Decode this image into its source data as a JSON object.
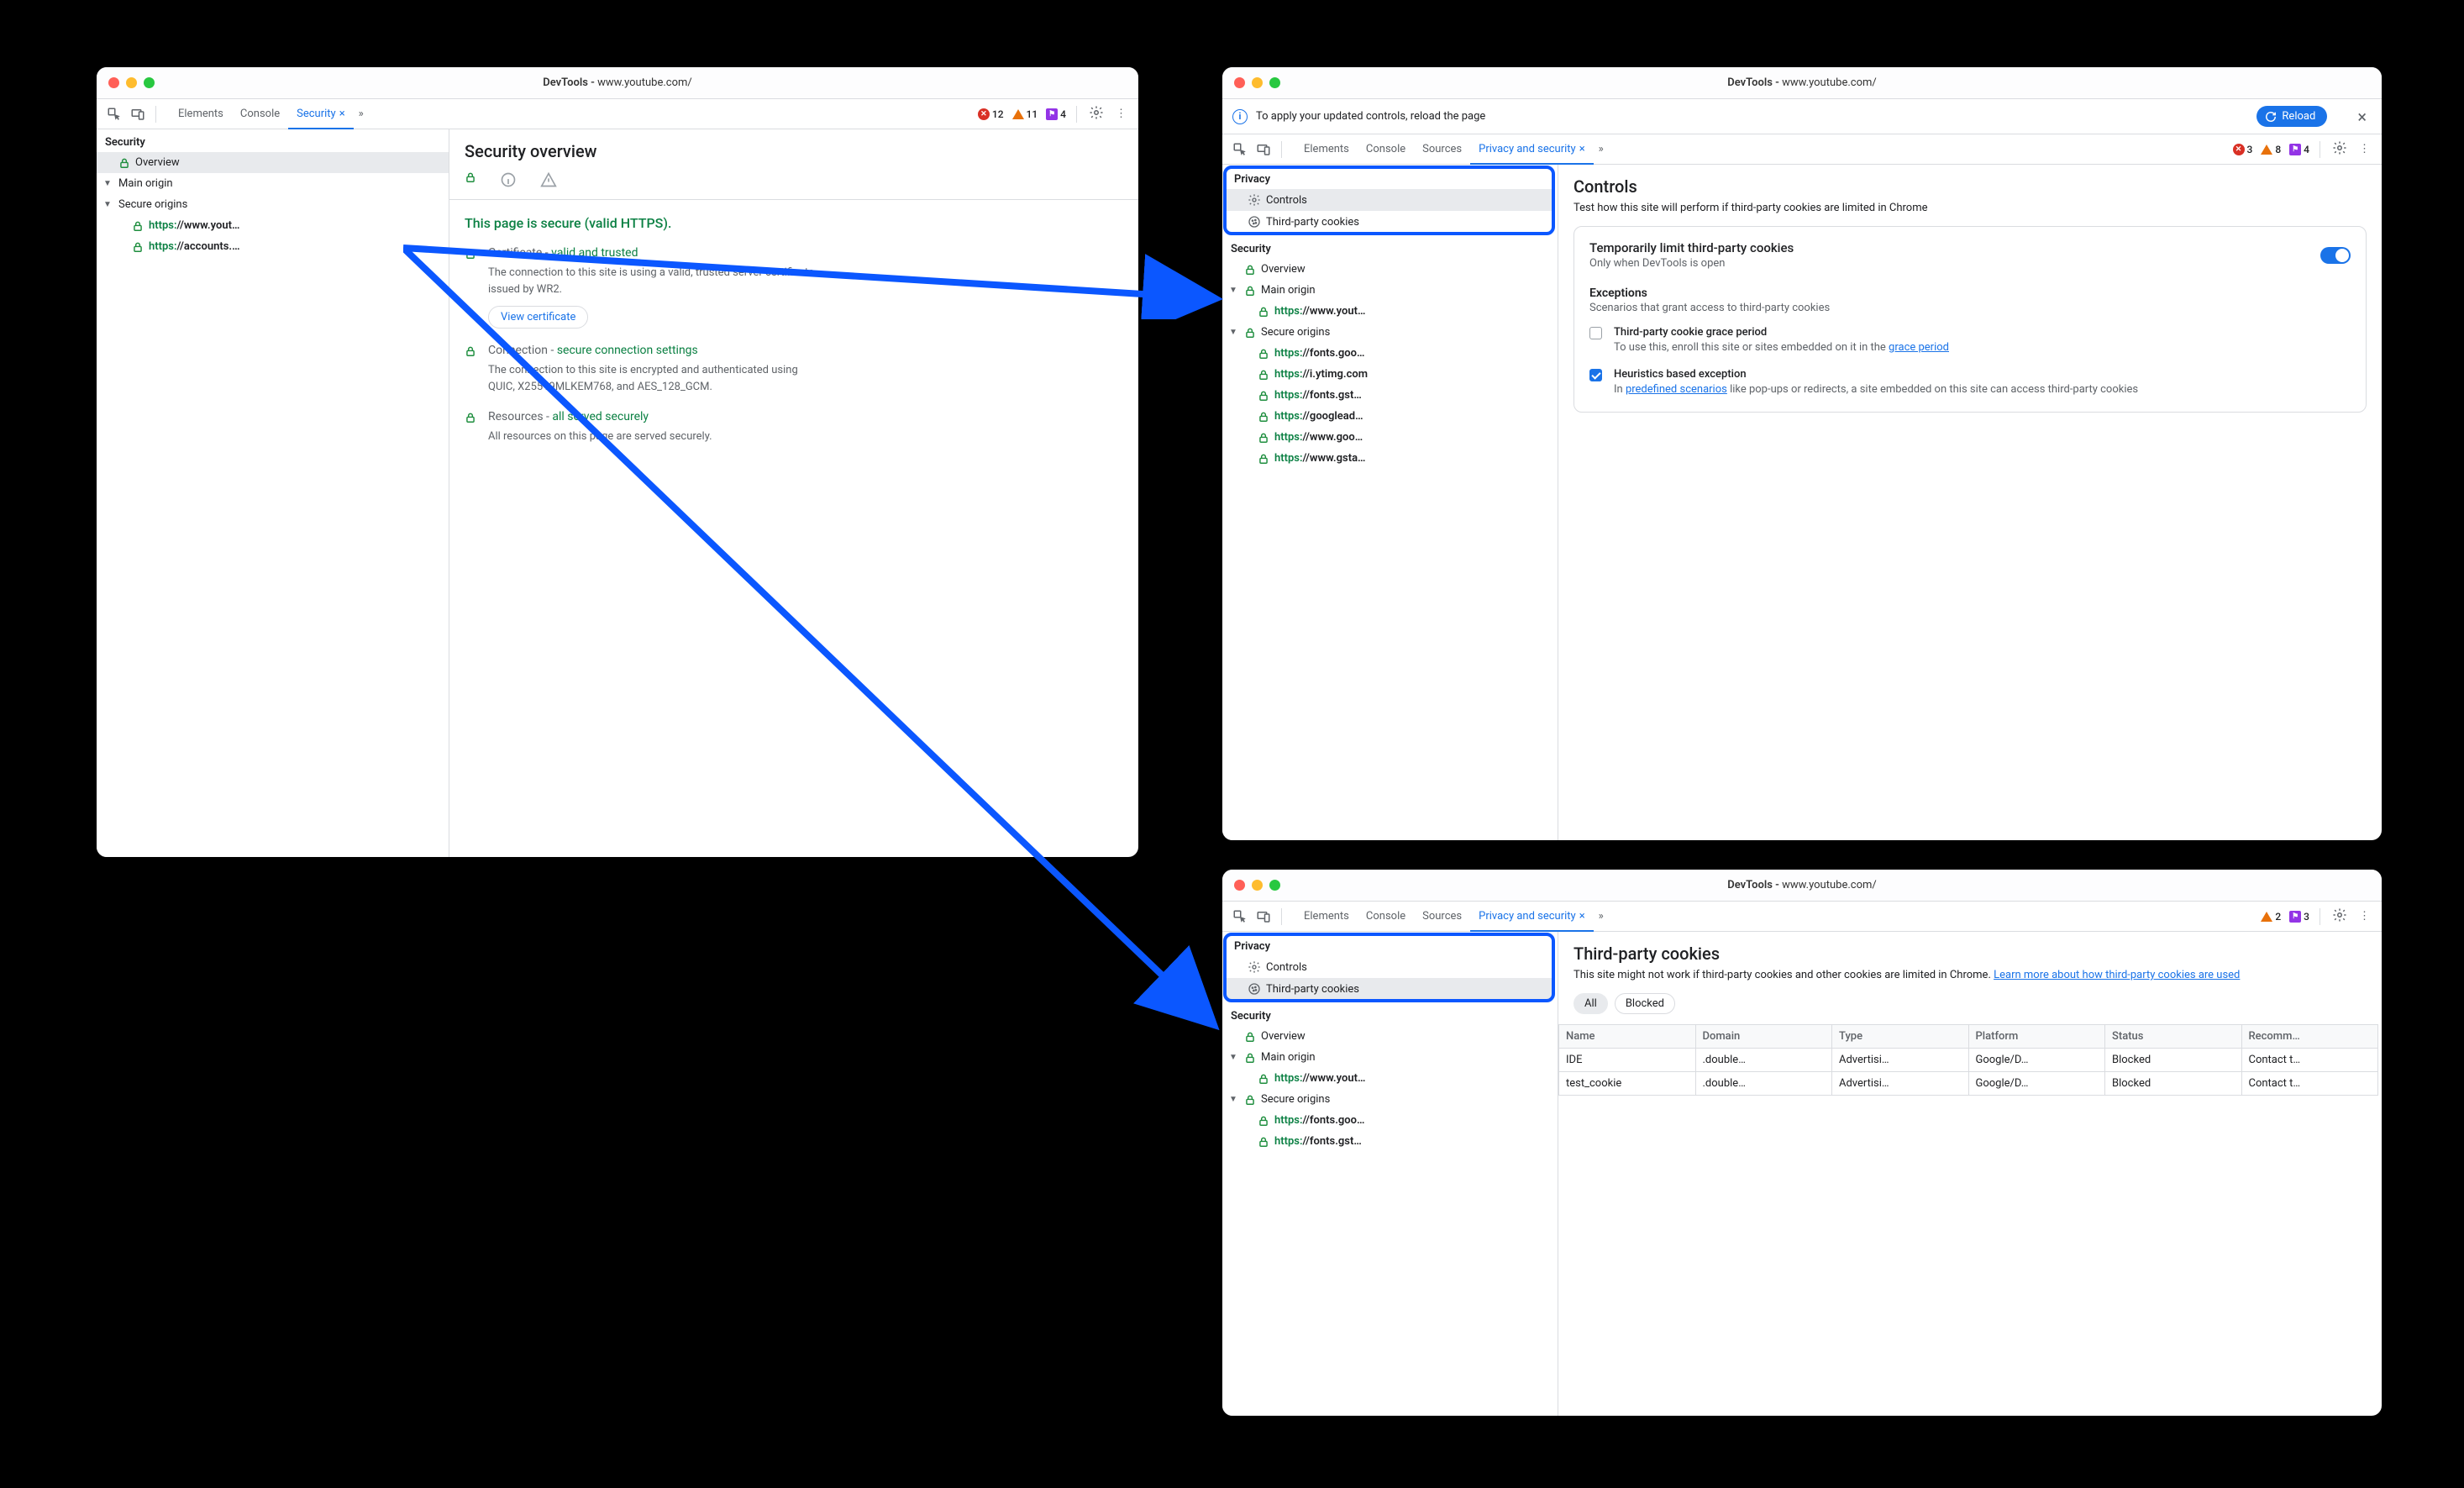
{
  "windows": {
    "a": {
      "title_prefix": "DevTools - ",
      "title_url": "www.youtube.com/"
    },
    "b": {
      "title_prefix": "DevTools - ",
      "title_url": "www.youtube.com/"
    },
    "c": {
      "title_prefix": "DevTools - ",
      "title_url": "www.youtube.com/"
    }
  },
  "tabsA": {
    "elements": "Elements",
    "console": "Console",
    "security": "Security"
  },
  "tabsB": {
    "elements": "Elements",
    "console": "Console",
    "sources": "Sources",
    "ps": "Privacy and security"
  },
  "countsA": {
    "err": "12",
    "warn": "11",
    "info": "4"
  },
  "countsB": {
    "err": "3",
    "warn": "8",
    "info": "4"
  },
  "countsC": {
    "warn": "2",
    "info": "3"
  },
  "sidebarA": {
    "head": "Security",
    "overview": "Overview",
    "main_origin": "Main origin",
    "secure_origins": "Secure origins",
    "origins": [
      {
        "scheme": "https:",
        "host": "//www.yout…"
      },
      {
        "scheme": "https:",
        "host": "//accounts.…"
      }
    ]
  },
  "paneA": {
    "title": "Security overview",
    "banner": "This page is secure (valid HTTPS).",
    "cert_label": "Certificate - ",
    "cert_ok": "valid and trusted",
    "cert_desc": "The connection to this site is using a valid, trusted server certificate issued by WR2.",
    "view_cert": "View certificate",
    "conn_label": "Connection - ",
    "conn_ok": "secure connection settings",
    "conn_desc": "The connection to this site is encrypted and authenticated using QUIC, X25519MLKEM768, and AES_128_GCM.",
    "res_label": "Resources - ",
    "res_ok": "all served securely",
    "res_desc": "All resources on this page are served securely."
  },
  "bannerB": {
    "text": "To apply your updated controls, reload the page",
    "reload": "Reload"
  },
  "sidebarB": {
    "privacy_head": "Privacy",
    "controls": "Controls",
    "tpc": "Third-party cookies",
    "security_head": "Security",
    "overview": "Overview",
    "main_origin": "Main origin",
    "main_origin_item": {
      "scheme": "https:",
      "host": "//www.yout…"
    },
    "secure_origins": "Secure origins",
    "secure_list": [
      {
        "scheme": "https:",
        "host": "//fonts.goo…"
      },
      {
        "scheme": "https:",
        "host": "//i.ytimg.com"
      },
      {
        "scheme": "https:",
        "host": "//fonts.gst…"
      },
      {
        "scheme": "https:",
        "host": "//googlead…"
      },
      {
        "scheme": "https:",
        "host": "//www.goo…"
      },
      {
        "scheme": "https:",
        "host": "//www.gsta…"
      }
    ]
  },
  "paneB": {
    "title": "Controls",
    "sub": "Test how this site will perform if third-party cookies are limited in Chrome",
    "card_title": "Temporarily limit third-party cookies",
    "card_sub": "Only when DevTools is open",
    "exc_head": "Exceptions",
    "exc_sub": "Scenarios that grant access to third-party cookies",
    "exc1_title": "Third-party cookie grace period",
    "exc1_desc_a": "To use this, enroll this site or sites embedded on it in the ",
    "exc1_link": "grace period",
    "exc2_title": "Heuristics based exception",
    "exc2_desc_a": "In ",
    "exc2_link": "predefined scenarios",
    "exc2_desc_b": " like pop-ups or redirects, a site embedded on this site can access third-party cookies"
  },
  "sidebarC": {
    "privacy_head": "Privacy",
    "controls": "Controls",
    "tpc": "Third-party cookies",
    "security_head": "Security",
    "overview": "Overview",
    "main_origin": "Main origin",
    "main_origin_item": {
      "scheme": "https:",
      "host": "//www.yout…"
    },
    "secure_origins": "Secure origins",
    "secure_list": [
      {
        "scheme": "https:",
        "host": "//fonts.goo…"
      },
      {
        "scheme": "https:",
        "host": "//fonts.gst…"
      }
    ]
  },
  "paneC": {
    "title": "Third-party cookies",
    "sub_a": "This site might not work if third-party cookies and other cookies are limited in Chrome. ",
    "sub_link": "Learn more about how third-party cookies are used",
    "filter_all": "All",
    "filter_blocked": "Blocked",
    "cols": [
      "Name",
      "Domain",
      "Type",
      "Platform",
      "Status",
      "Recomm…"
    ],
    "rows": [
      [
        "IDE",
        ".double…",
        "Advertisi…",
        "Google/D…",
        "Blocked",
        "Contact t…"
      ],
      [
        "test_cookie",
        ".double…",
        "Advertisi…",
        "Google/D…",
        "Blocked",
        "Contact t…"
      ]
    ]
  }
}
